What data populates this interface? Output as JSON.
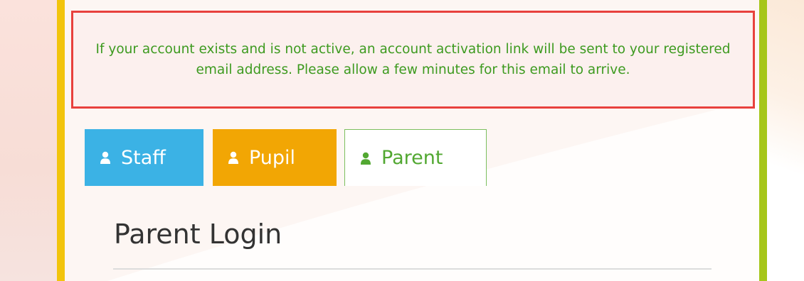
{
  "alert": {
    "message": "If your account exists and is not active, an account activation link will be sent to your registered email address. Please allow a few minutes for this email to arrive."
  },
  "tabs": [
    {
      "label": "Staff",
      "icon": "user-icon",
      "active": false,
      "color": "#3bb2e5"
    },
    {
      "label": "Pupil",
      "icon": "user-icon",
      "active": false,
      "color": "#f2a604"
    },
    {
      "label": "Parent",
      "icon": "user-icon",
      "active": true,
      "color": "#52a832"
    }
  ],
  "login": {
    "heading": "Parent Login"
  },
  "colors": {
    "alert_border": "#e8413d",
    "alert_text": "#3d9a1f",
    "left_bar": "#f2c40c",
    "right_bar": "#a6c61a"
  }
}
